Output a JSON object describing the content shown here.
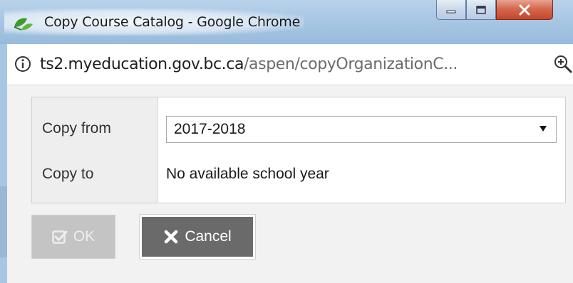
{
  "window": {
    "title": "Copy Course Catalog - Google Chrome",
    "app_icon": "chrome-leaf-icon",
    "controls": [
      "minimize-icon",
      "maximize-icon",
      "close-icon"
    ]
  },
  "addressbar": {
    "url_host": "ts2.myeducation.gov.bc.ca",
    "url_path": "/aspen/copyOrganizationC...",
    "info_icon": "info-icon",
    "zoom_icon": "zoom-icon"
  },
  "form": {
    "copy_from": {
      "label": "Copy from",
      "selected": "2017-2018"
    },
    "copy_to": {
      "label": "Copy to",
      "value": "No available school year"
    }
  },
  "buttons": {
    "ok": {
      "label": "OK",
      "icon": "checkbox-check-icon",
      "enabled": false
    },
    "cancel": {
      "label": "Cancel",
      "icon": "x-icon",
      "enabled": true
    }
  },
  "colors": {
    "titlebar": "#a9c7e4",
    "close_button": "#c5462a",
    "cancel_button": "#6a6a6a",
    "ok_disabled": "#c4c4c4"
  }
}
